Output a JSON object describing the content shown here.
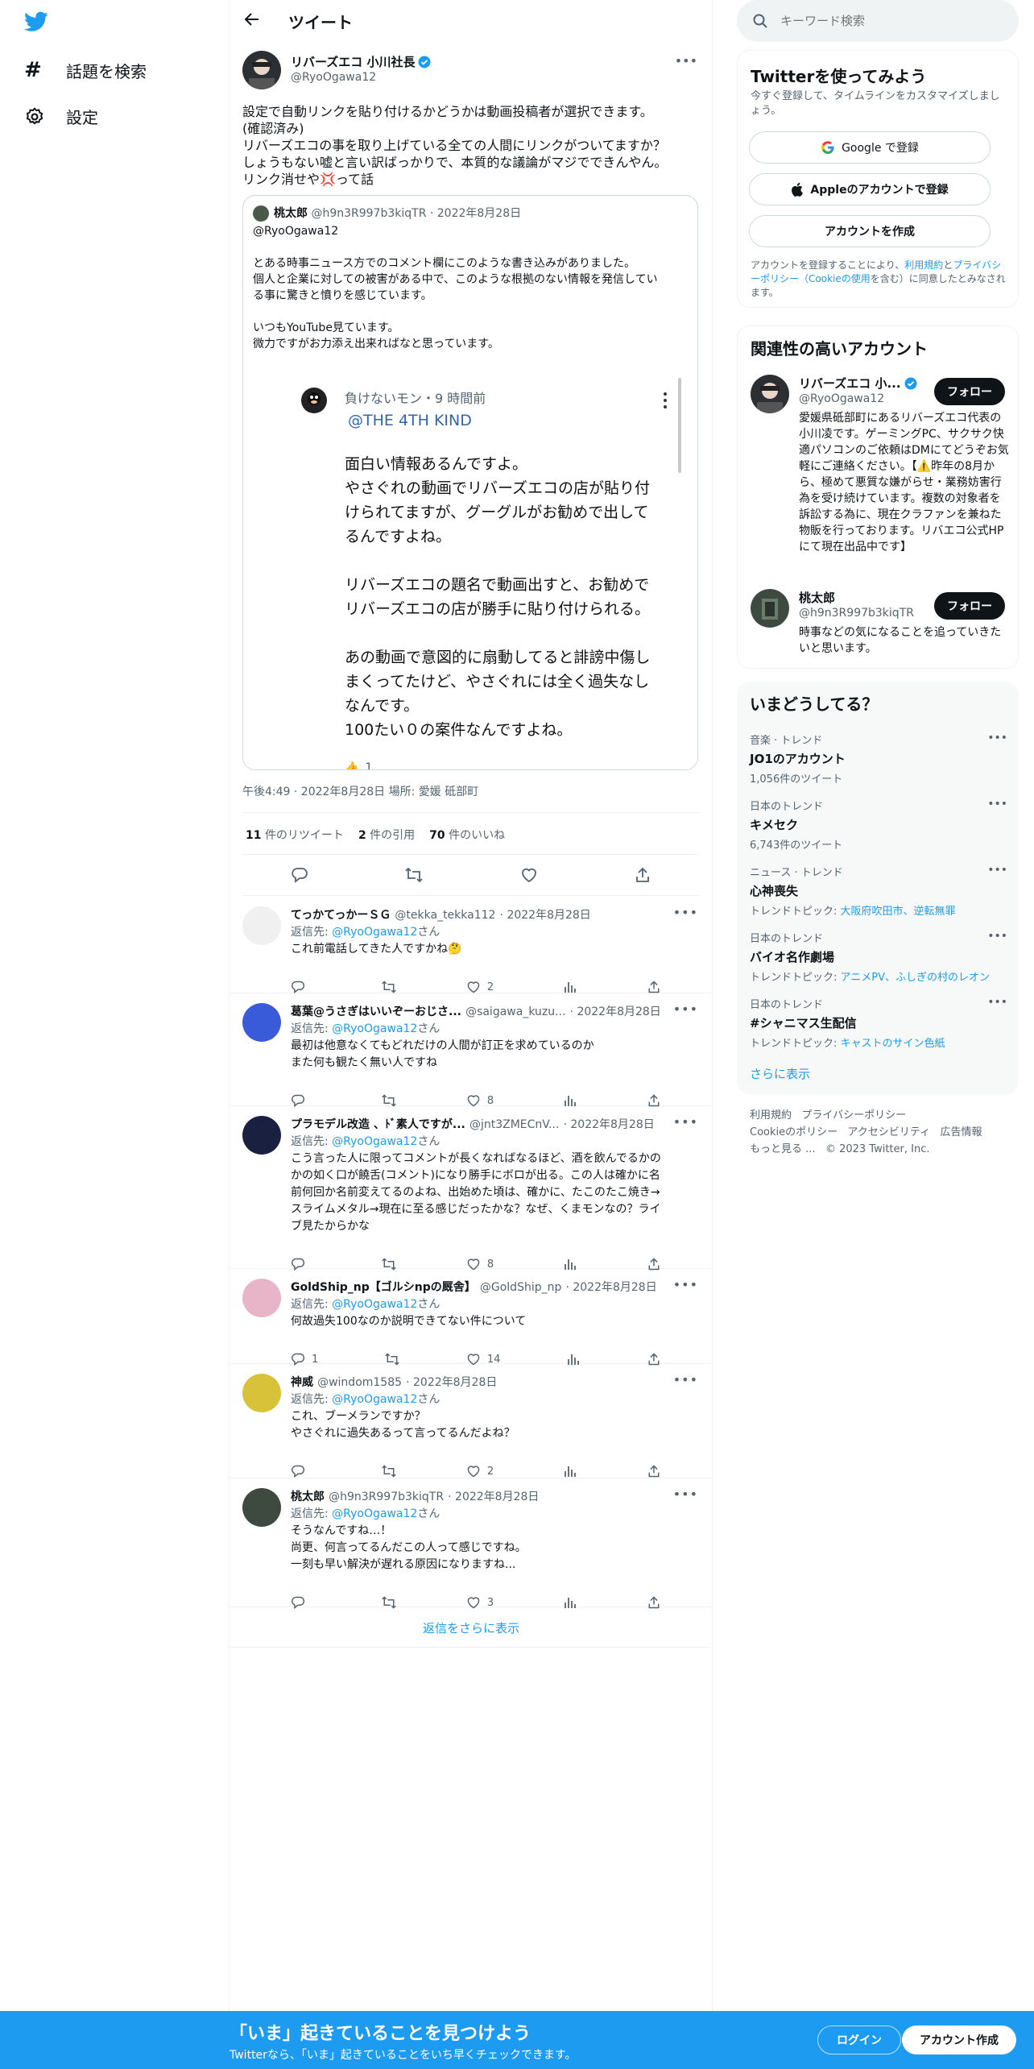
{
  "left_nav": {
    "explore_label": "話題を検索",
    "settings_label": "設定"
  },
  "header": {
    "title": "ツイート"
  },
  "main_tweet": {
    "display_name": "リバーズエコ 小川社長",
    "handle": "@RyoOgawa12",
    "text_lines": [
      "設定で自動リンクを貼り付けるかどうかは動画投稿者が選択できます。",
      "(確認済み)",
      "リバーズエコの事を取り上げている全ての人間にリンクがついてますか？",
      "しょうもない嘘と言い訳ばっかりで、本質的な議論がマジでできんやん。",
      "リンク消せや💢って話"
    ],
    "quote": {
      "display_name": "桃太郎",
      "handle": "@h9n3R997b3kiqTR",
      "date": "· 2022年8月28日",
      "reply_to": "@RyoOgawa12",
      "text_lines": [
        "とある時事ニュース方でのコメント欄にこのような書き込みがありました。",
        "個人と企業に対しての被害がある中で、このような根拠のない情報を発信してい",
        "る事に驚きと憤りを感じています。",
        "",
        "いつもYouTube見ています。",
        "微力ですがお力添え出来ればなと思っています。"
      ],
      "embedded": {
        "author": "負けないモン・9 時間前",
        "mention": "@THE 4TH KIND",
        "lines": [
          "面白い情報あるんですよ。",
          "やさぐれの動画でリバーズエコの店が貼り付",
          "けられてますが、グーグルがお勧めで出して",
          "るんですよね。",
          "",
          "リバーズエコの題名で動画出すと、お勧めで",
          "リバーズエコの店が勝手に貼り付けられる。",
          "",
          "あの動画で意図的に扇動してると誹謗中傷し",
          "まくってたけど、やさぐれには全く過失なし",
          "なんです。",
          "100たい０の案件なんですよね。"
        ],
        "like_count": "1"
      }
    },
    "timestamp": "午後4:49 · 2022年8月28日 場所: 愛媛 砥部町",
    "stats": {
      "retweets_num": "11",
      "retweets_label": "件のリツイート",
      "quotes_num": "2",
      "quotes_label": "件の引用",
      "likes_num": "70",
      "likes_label": "件のいいね"
    }
  },
  "replies": [
    {
      "name": "てっかてっかーＳＧ",
      "handle": "@tekka_tekka112",
      "date": "· 2022年8月28日",
      "reply_prefix": "返信先:",
      "reply_to": "@RyoOgawa12",
      "reply_suffix": "さん",
      "lines": [
        "これ前電話してきた人ですかね🤔"
      ],
      "replies": "",
      "likes": "2"
    },
    {
      "name": "葛葉@うさぎはいいぞーおじさ...",
      "handle": "@saigawa_kuzu...",
      "date": "· 2022年8月28日",
      "reply_prefix": "返信先:",
      "reply_to": "@RyoOgawa12",
      "reply_suffix": "さん",
      "lines": [
        "最初は他意なくてもどれだけの人間が訂正を求めているのか",
        "また何も観たく無い人ですね"
      ],
      "replies": "",
      "likes": "8"
    },
    {
      "name": "プラモデル改造 、ﾄﾞ素人ですが...",
      "handle": "@jnt3ZMECnV...",
      "date": "· 2022年8月28日",
      "reply_prefix": "返信先:",
      "reply_to": "@RyoOgawa12",
      "reply_suffix": "さん",
      "lines": [
        "こう言った人に限ってコメントが長くなればなるほど、酒を飲んでるかの",
        "かの如く口が饒舌(コメント)になり勝手にボロが出る。この人は確かに名",
        "前何回か名前変えてるのよね、出始めた頃は、確かに、たこのたこ焼き→",
        "スライムメタル→現在に至る感じだったかな？なぜ、くまモンなの？ライ",
        "ブ見たからかな"
      ],
      "replies": "",
      "likes": "8"
    },
    {
      "name": "GoldShip_np【ゴルシnpの厩舎】",
      "handle": "@GoldShip_np",
      "date": "· 2022年8月28日",
      "reply_prefix": "返信先:",
      "reply_to": "@RyoOgawa12",
      "reply_suffix": "さん",
      "lines": [
        "何故過失100なのか説明できてない件について"
      ],
      "replies": "1",
      "likes": "14"
    },
    {
      "name": "神威",
      "handle": "@windom1585",
      "date": "· 2022年8月28日",
      "reply_prefix": "返信先:",
      "reply_to": "@RyoOgawa12",
      "reply_suffix": "さん",
      "lines": [
        "これ、ブーメランですか？",
        "やさぐれに過失あるって言ってるんだよね？"
      ],
      "replies": "",
      "likes": "2"
    },
    {
      "name": "桃太郎",
      "handle": "@h9n3R997b3kiqTR",
      "date": "· 2022年8月28日",
      "reply_prefix": "返信先:",
      "reply_to": "@RyoOgawa12",
      "reply_suffix": "さん",
      "lines": [
        "そうなんですね…！",
        "尚更、何言ってるんだこの人って感じですね。",
        "一刻も早い解決が遅れる原因になりますね..."
      ],
      "replies": "",
      "likes": "3"
    }
  ],
  "show_more_replies": "返信をさらに表示",
  "right": {
    "search_placeholder": "キーワード検索",
    "signup": {
      "title": "Twitterを使ってみよう",
      "subtitle": "今すぐ登録して、タイムラインをカスタマイズしましょう。",
      "google_label": "Google で登録",
      "apple_label": "Appleのアカウントで登録",
      "create_label": "アカウントを作成",
      "terms_prefix": "アカウントを登録することにより、",
      "terms_link": "利用規約",
      "terms_and": "と",
      "privacy_link": "プライバシーポリシー（Cookieの使用",
      "terms_suffix": "を含む）に同意したとみなされます。"
    },
    "related": {
      "title": "関連性の高いアカウント",
      "accounts": [
        {
          "name": "リバーズエコ 小...",
          "handle": "@RyoOgawa12",
          "follow": "フォロー",
          "bio": "愛媛県砥部町にあるリバーズエコ代表の小川凌です。ゲーミングPC、サクサク快適パソコンのご依頼はDMにてどうぞお気軽にご連絡ください。【⚠️昨年の8月から、極めて悪質な嫌がらせ・業務妨害行為を受け続けています。複数の対象者を訴訟する為に、現在クラファンを兼ねた物販を行っております。リバエコ公式HPにて現在出品中です】"
        },
        {
          "name": "桃太郎",
          "handle": "@h9n3R997b3kiqTR",
          "follow": "フォロー",
          "bio": "時事などの気になることを追っていきたいと思います。"
        }
      ]
    },
    "trends": {
      "title": "いまどうしてる？",
      "items": [
        {
          "category": "音楽 · トレンド",
          "title": "JO1のアカウント",
          "sub": "1,056件のツイート",
          "topic_prefix": "",
          "topic": ""
        },
        {
          "category": "日本のトレンド",
          "title": "キメセク",
          "sub": "6,743件のツイート",
          "topic_prefix": "",
          "topic": ""
        },
        {
          "category": "ニュース · トレンド",
          "title": "心神喪失",
          "sub": "",
          "topic_prefix": "トレンドトピック: ",
          "topic": "大阪府吹田市、逆転無罪"
        },
        {
          "category": "日本のトレンド",
          "title": "バイオ名作劇場",
          "sub": "",
          "topic_prefix": "トレンドトピック: ",
          "topic": "アニメPV、ふしぎの村のレオン"
        },
        {
          "category": "日本のトレンド",
          "title": "#シャニマス生配信",
          "sub": "",
          "topic_prefix": "トレンドトピック: ",
          "topic": "キャストのサイン色紙"
        }
      ],
      "show_more": "さらに表示"
    },
    "footer": {
      "line1": [
        "利用規約",
        "プライバシーポリシー"
      ],
      "line2": [
        "Cookieのポリシー",
        "アクセシビリティ",
        "広告情報"
      ],
      "line3_more": "もっと見る ...",
      "copyright": "© 2023 Twitter, Inc."
    }
  },
  "bottom_bar": {
    "title": "「いま」起きていることを見つけよう",
    "subtitle": "Twitterなら、「いま」起きていることをいち早くチェックできます。",
    "login": "ログイン",
    "signup": "アカウント作成"
  },
  "colors": {
    "accent": "#1d9bf0",
    "text": "#0f1419",
    "muted": "#536471"
  }
}
